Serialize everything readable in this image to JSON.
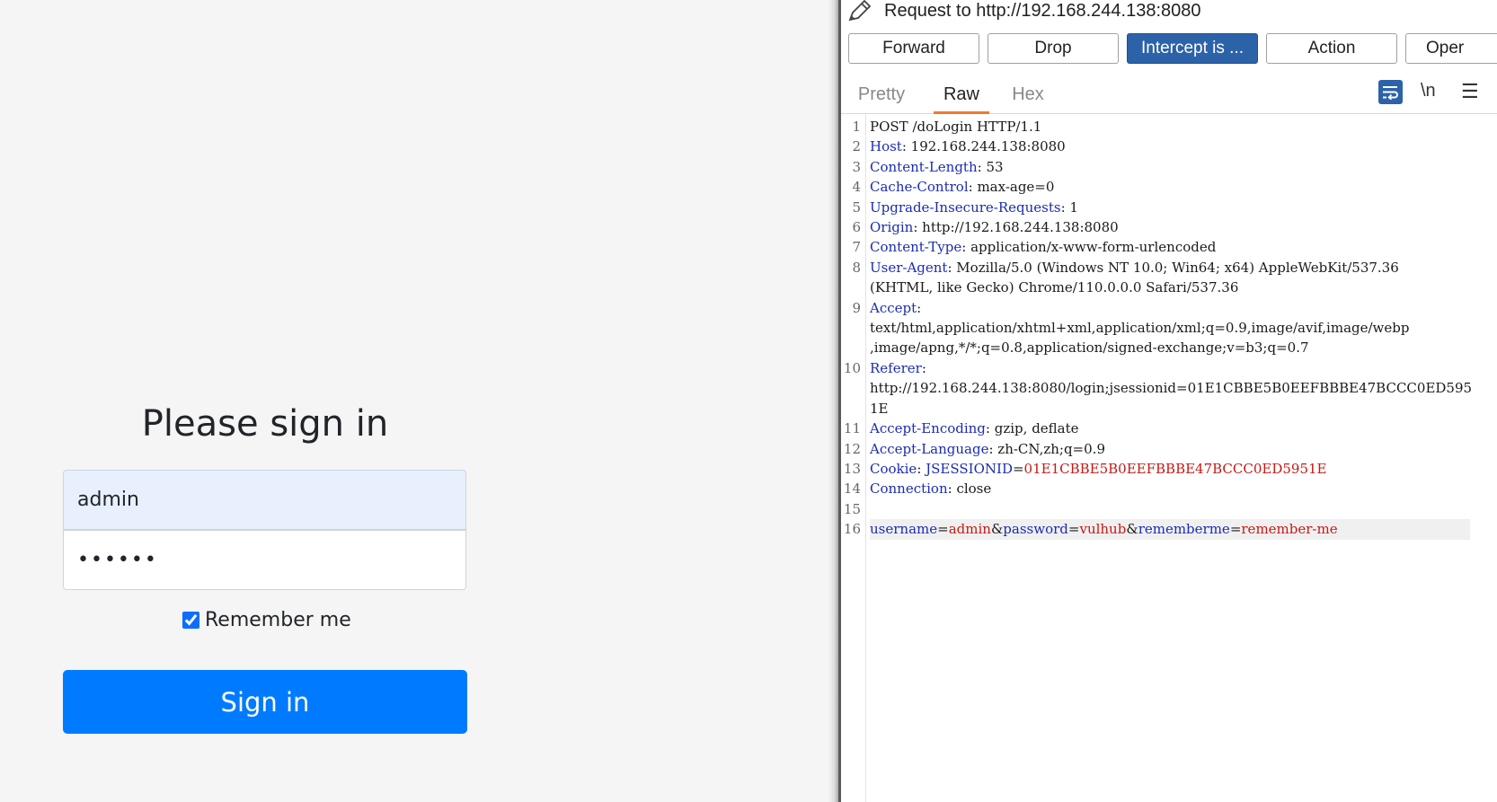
{
  "login": {
    "title": "Please sign in",
    "username_value": "admin",
    "password_value": "••••••",
    "remember_label": "Remember me",
    "signin_label": "Sign in"
  },
  "intercept": {
    "request_title": "Request to http://192.168.244.138:8080",
    "buttons": {
      "forward": "Forward",
      "drop": "Drop",
      "intercept": "Intercept is ...",
      "action": "Action",
      "open": "Oper"
    },
    "tabs": {
      "pretty": "Pretty",
      "raw": "Raw",
      "hex": "Hex"
    },
    "newline_label": "\\n",
    "menu_label": "☰",
    "accent_color": "#2c62a8",
    "tab_active_color": "#f07a2f",
    "lines": [
      {
        "n": "1",
        "text": "POST /doLogin HTTP/1.1"
      },
      {
        "n": "2",
        "key": "Host",
        "value": " 192.168.244.138:8080"
      },
      {
        "n": "3",
        "key": "Content-Length",
        "value": " 53"
      },
      {
        "n": "4",
        "key": "Cache-Control",
        "value": " max-age=0"
      },
      {
        "n": "5",
        "key": "Upgrade-Insecure-Requests",
        "value": " 1"
      },
      {
        "n": "6",
        "key": "Origin",
        "value": " http://192.168.244.138:8080"
      },
      {
        "n": "7",
        "key": "Content-Type",
        "value": " application/x-www-form-urlencoded"
      },
      {
        "n": "8",
        "key": "User-Agent",
        "value": " Mozilla/5.0 (Windows NT 10.0; Win64; x64) AppleWebKit/537.36"
      },
      {
        "n": "",
        "text": "(KHTML, like Gecko) Chrome/110.0.0.0 Safari/537.36"
      },
      {
        "n": "9",
        "key": "Accept",
        "value": ""
      },
      {
        "n": "",
        "text": "text/html,application/xhtml+xml,application/xml;q=0.9,image/avif,image/webp"
      },
      {
        "n": "",
        "text": ",image/apng,*/*;q=0.8,application/signed-exchange;v=b3;q=0.7"
      },
      {
        "n": "10",
        "key": "Referer",
        "value": ""
      },
      {
        "n": "",
        "text": "http://192.168.244.138:8080/login;jsessionid=01E1CBBE5B0EEFBBBE47BCCC0ED595"
      },
      {
        "n": "",
        "text": "1E"
      },
      {
        "n": "11",
        "key": "Accept-Encoding",
        "value": " gzip, deflate"
      },
      {
        "n": "12",
        "key": "Accept-Language",
        "value": " zh-CN,zh;q=0.9"
      },
      {
        "n": "13",
        "key": "Cookie",
        "cookie_name": "JSESSIONID",
        "cookie_value": "01E1CBBE5B0EEFBBBE47BCCC0ED5951E"
      },
      {
        "n": "14",
        "key": "Connection",
        "value": " close"
      },
      {
        "n": "15",
        "text": ""
      },
      {
        "n": "16",
        "body": [
          {
            "k": "username",
            "v": "admin"
          },
          {
            "k": "password",
            "v": "vulhub"
          },
          {
            "k": "rememberme",
            "v": "remember-me"
          }
        ]
      }
    ]
  }
}
